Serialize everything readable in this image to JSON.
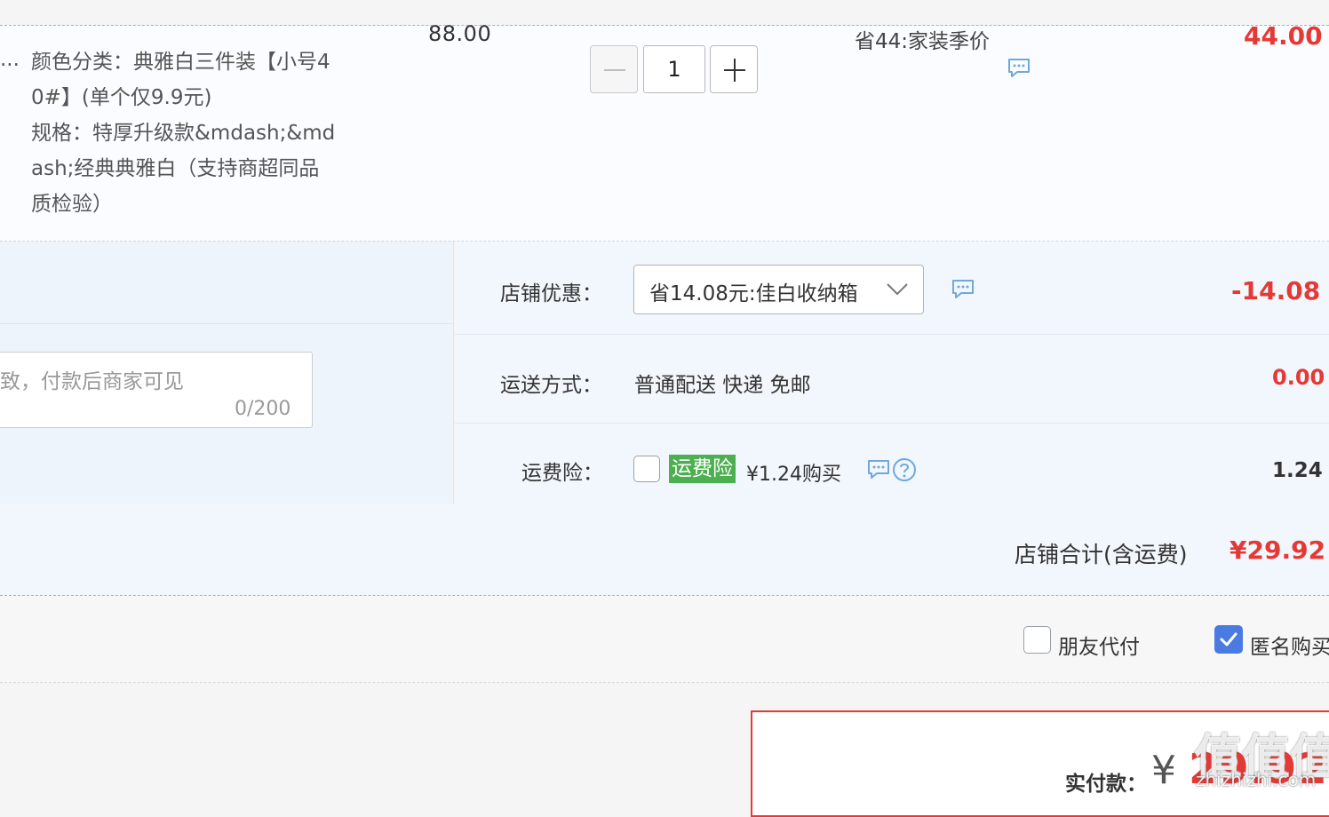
{
  "item": {
    "ellipsis": "...",
    "sku_lines": [
      "颜色分类：典雅白三件装【小号4",
      "0#】(单个仅9.9元)",
      "规格：特厚升级款&mdash;&md",
      "ash;经典典雅白（支持商超同品",
      "质检验）"
    ],
    "price": "88.00",
    "quantity": "1",
    "promo": "省44:家装季价",
    "total": "44.00"
  },
  "memo": {
    "placeholder": "致，付款后商家可见",
    "count": "0/200"
  },
  "shop": {
    "discount_label": "店铺优惠：",
    "discount_value": "省14.08元:佳白收纳箱",
    "discount_amount": "-14.08",
    "shipping_label": "运送方式：",
    "shipping_value": "普通配送 快递 免邮",
    "shipping_amount": "0.00",
    "insurance_label": "运费险：",
    "insurance_badge": "运费险",
    "insurance_price": "¥1.24购买",
    "insurance_amount": "1.24",
    "total_label": "店铺合计(含运费)",
    "total_value": "¥29.92"
  },
  "options": {
    "friend_pay": "朋友代付",
    "anonymous": "匿名购买"
  },
  "payment": {
    "label": "实付款：",
    "yen": "¥",
    "amount": "29.92"
  },
  "watermark": {
    "text": "值值值",
    "sub": "zhizhizhi.com"
  },
  "colors": {
    "accent_red": "#e53935",
    "check_blue": "#4a7be0",
    "badge_green": "#4caf50"
  }
}
